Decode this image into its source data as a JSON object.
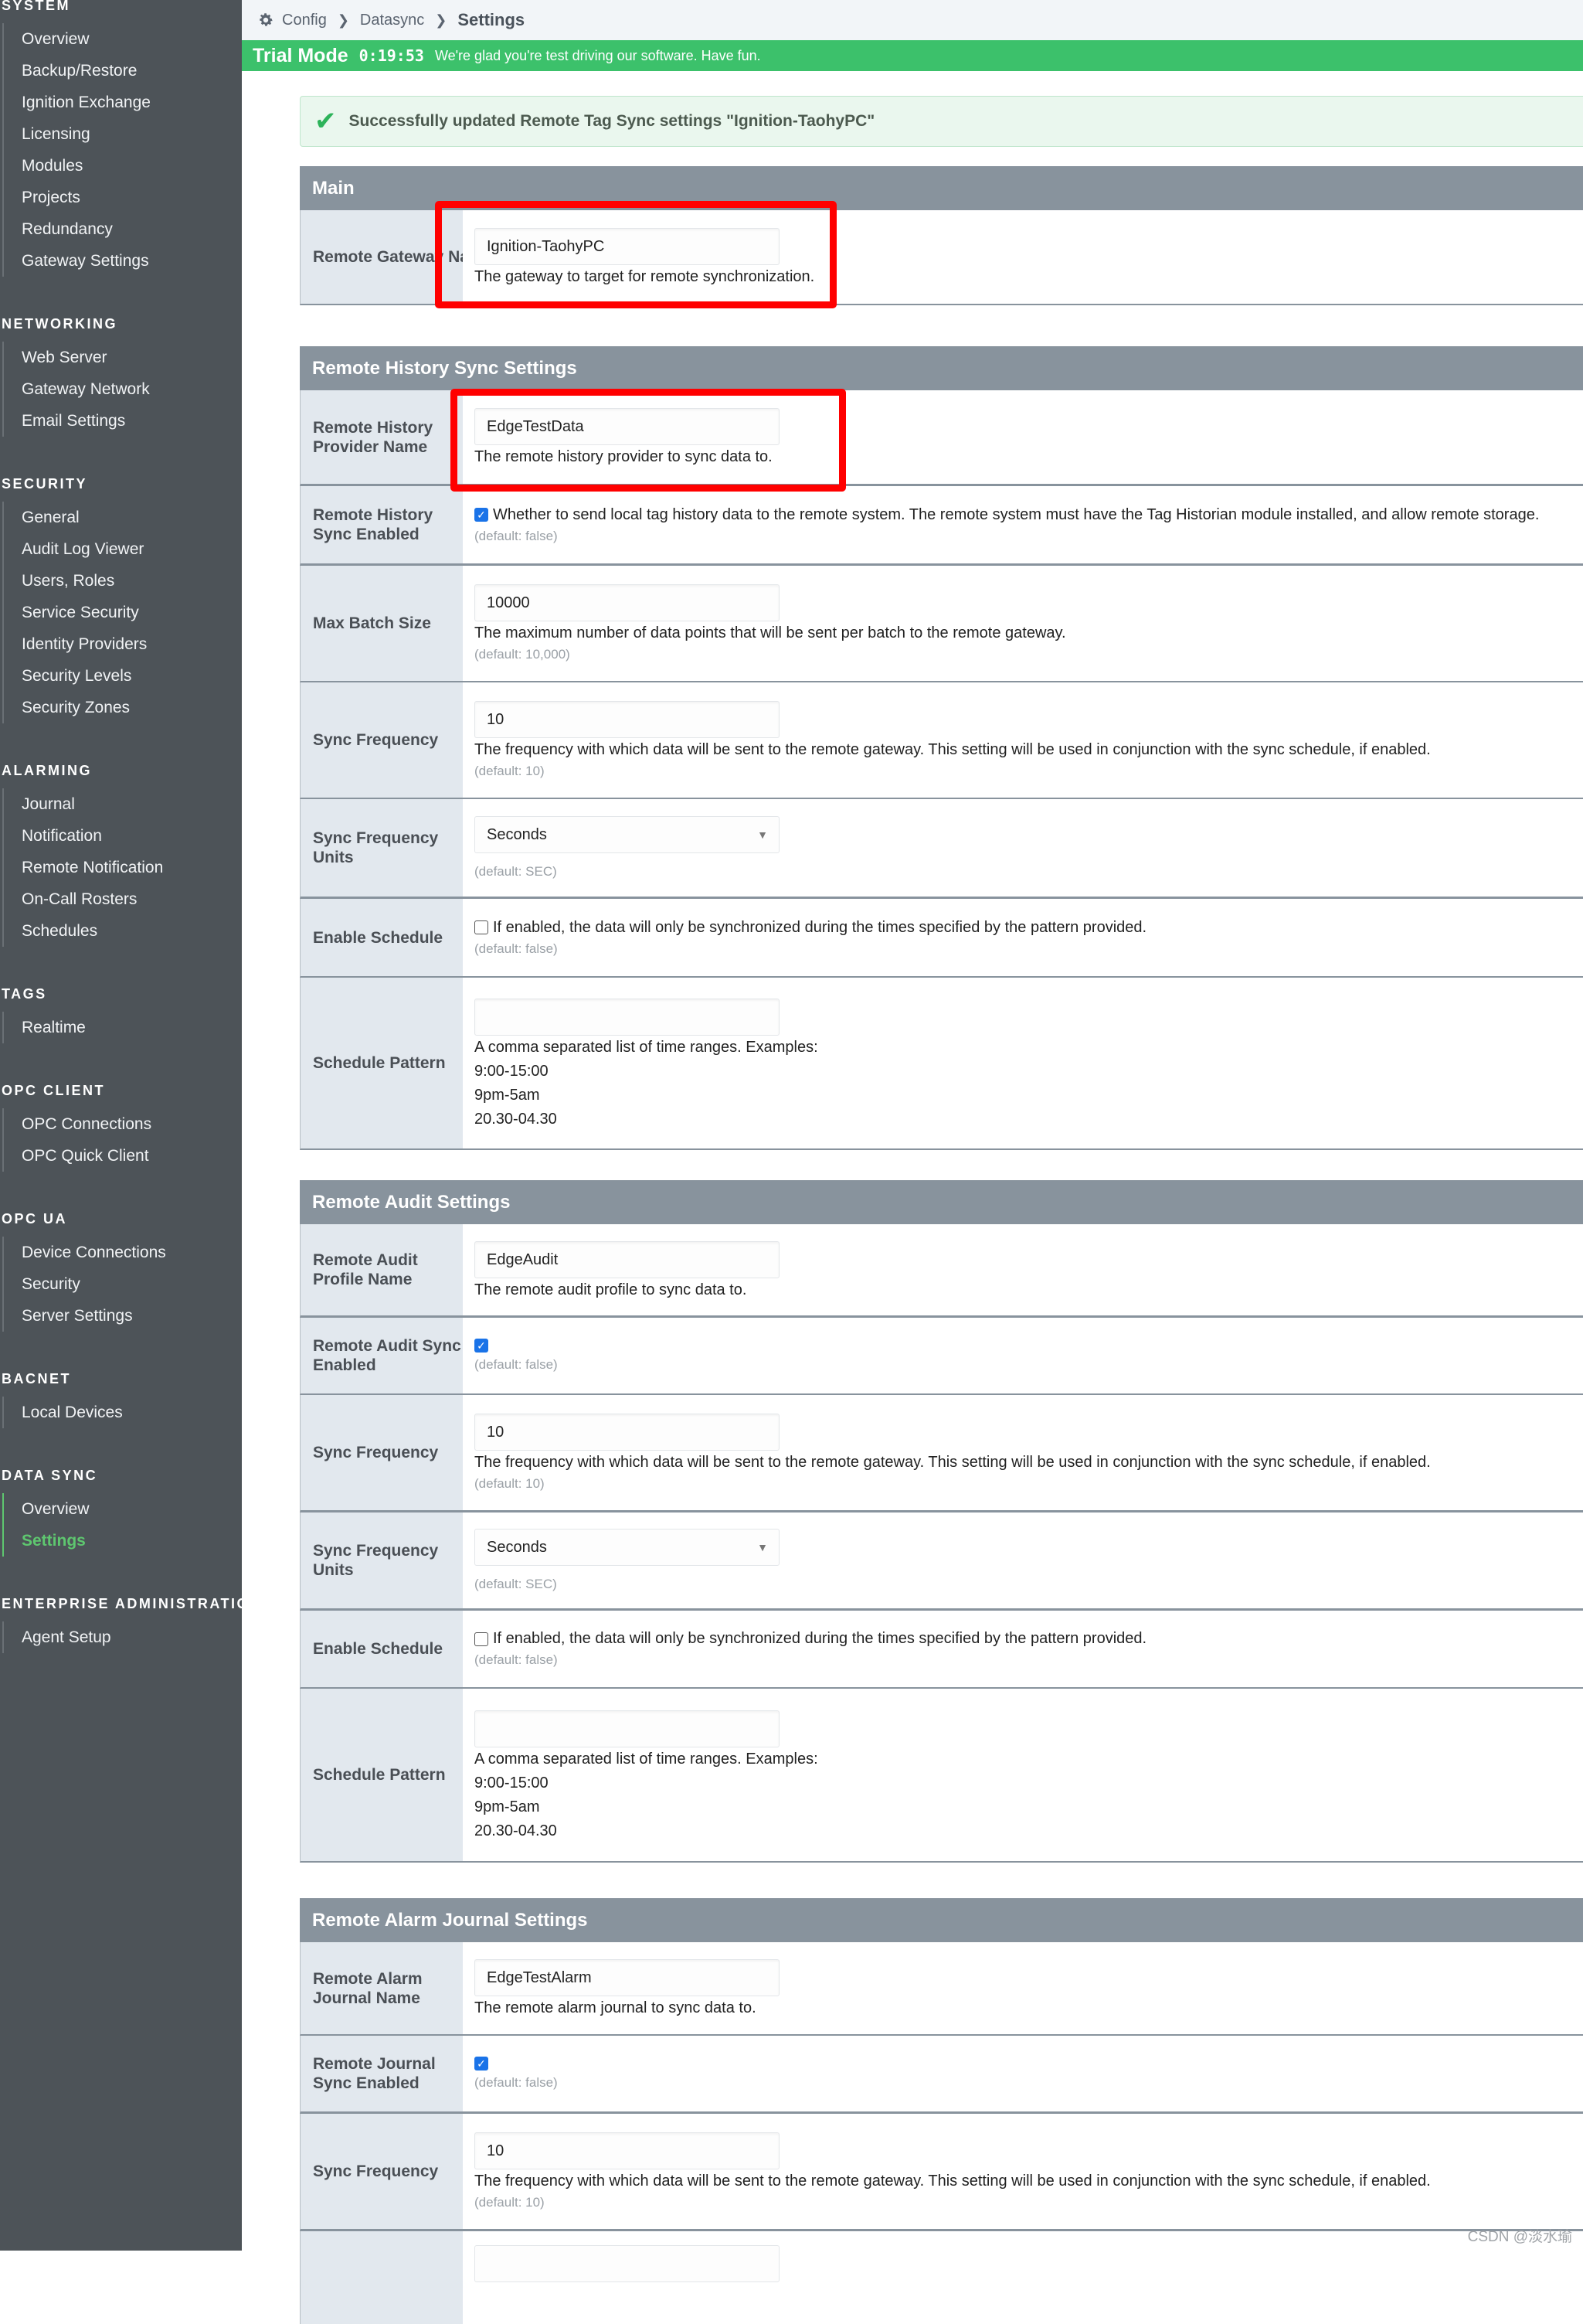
{
  "breadcrumb": {
    "items": [
      "Config",
      "Datasync"
    ],
    "current": "Settings",
    "icon": "gear-icon"
  },
  "trial": {
    "mode": "Trial Mode",
    "timer": "0:19:53",
    "message": "We're glad you're test driving our software. Have fun."
  },
  "success": {
    "icon": "check-icon",
    "message": "Successfully updated Remote Tag Sync settings \"Ignition-TaohyPC\""
  },
  "sidebar": {
    "groups": [
      {
        "header": "SYSTEM",
        "items": [
          "Overview",
          "Backup/Restore",
          "Ignition Exchange",
          "Licensing",
          "Modules",
          "Projects",
          "Redundancy",
          "Gateway Settings"
        ]
      },
      {
        "header": "NETWORKING",
        "items": [
          "Web Server",
          "Gateway Network",
          "Email Settings"
        ]
      },
      {
        "header": "SECURITY",
        "items": [
          "General",
          "Audit Log Viewer",
          "Users, Roles",
          "Service Security",
          "Identity Providers",
          "Security Levels",
          "Security Zones"
        ]
      },
      {
        "header": "ALARMING",
        "items": [
          "Journal",
          "Notification",
          "Remote Notification",
          "On-Call Rosters",
          "Schedules"
        ]
      },
      {
        "header": "TAGS",
        "items": [
          "Realtime"
        ]
      },
      {
        "header": "OPC CLIENT",
        "items": [
          "OPC Connections",
          "OPC Quick Client"
        ]
      },
      {
        "header": "OPC UA",
        "items": [
          "Device Connections",
          "Security",
          "Server Settings"
        ]
      },
      {
        "header": "BACNET",
        "items": [
          "Local Devices"
        ]
      },
      {
        "header": "DATA SYNC",
        "items": [
          "Overview",
          "Settings"
        ],
        "active_index": 1
      },
      {
        "header": "ENTERPRISE ADMINISTRATION",
        "items": [
          "Agent Setup"
        ]
      }
    ]
  },
  "main": {
    "title": "Main",
    "gateway_label": "Remote Gateway Name",
    "gateway_value": "Ignition-TaohyPC",
    "gateway_help": "The gateway to target for remote synchronization."
  },
  "history": {
    "title": "Remote History Sync Settings",
    "provider_label": "Remote History Provider Name",
    "provider_value": "EdgeTestData",
    "provider_help": "The remote history provider to sync data to.",
    "enabled_label": "Remote History Sync Enabled",
    "enabled_checked": true,
    "enabled_help": "Whether to send local tag history data to the remote system. The remote system must have the Tag Historian module installed, and allow remote storage.",
    "enabled_default": "(default: false)",
    "batch_label": "Max Batch Size",
    "batch_value": "10000",
    "batch_help": "The maximum number of data points that will be sent per batch to the remote gateway.",
    "batch_default": "(default: 10,000)",
    "freq_label": "Sync Frequency",
    "freq_value": "10",
    "freq_help": "The frequency with which data will be sent to the remote gateway. This setting will be used in conjunction with the sync schedule, if enabled.",
    "freq_default": "(default: 10)",
    "units_label": "Sync Frequency Units",
    "units_value": "Seconds",
    "units_default": "(default: SEC)",
    "schedule_label": "Enable Schedule",
    "schedule_checked": false,
    "schedule_help": "If enabled, the data will only be synchronized during the times specified by the pattern provided.",
    "schedule_default": "(default: false)",
    "pattern_label": "Schedule Pattern",
    "pattern_value": "",
    "pattern_help": "A comma separated list of time ranges. Examples:",
    "pattern_examples": [
      "9:00-15:00",
      "9pm-5am",
      "20.30-04.30"
    ]
  },
  "audit": {
    "title": "Remote Audit Settings",
    "profile_label": "Remote Audit Profile Name",
    "profile_value": "EdgeAudit",
    "profile_help": "The remote audit profile to sync data to.",
    "enabled_label": "Remote Audit Sync Enabled",
    "enabled_checked": true,
    "enabled_default": "(default: false)",
    "freq_label": "Sync Frequency",
    "freq_value": "10",
    "freq_help": "The frequency with which data will be sent to the remote gateway. This setting will be used in conjunction with the sync schedule, if enabled.",
    "freq_default": "(default: 10)",
    "units_label": "Sync Frequency Units",
    "units_value": "Seconds",
    "units_default": "(default: SEC)",
    "schedule_label": "Enable Schedule",
    "schedule_checked": false,
    "schedule_help": "If enabled, the data will only be synchronized during the times specified by the pattern provided.",
    "schedule_default": "(default: false)",
    "pattern_label": "Schedule Pattern",
    "pattern_value": "",
    "pattern_help": "A comma separated list of time ranges. Examples:",
    "pattern_examples": [
      "9:00-15:00",
      "9pm-5am",
      "20.30-04.30"
    ]
  },
  "alarm": {
    "title": "Remote Alarm Journal Settings",
    "journal_label": "Remote Alarm Journal Name",
    "journal_value": "EdgeTestAlarm",
    "journal_help": "The remote alarm journal to sync data to.",
    "enabled_label": "Remote Journal Sync Enabled",
    "enabled_checked": true,
    "enabled_default": "(default: false)",
    "freq_label": "Sync Frequency",
    "freq_value": "10",
    "freq_help": "The frequency with which data will be sent to the remote gateway. This setting will be used in conjunction with the sync schedule, if enabled.",
    "freq_default": "(default: 10)"
  },
  "colors": {
    "sidebar_bg": "#4d5358",
    "trial_green": "#3cc16b",
    "active_nav": "#5ec76f",
    "section_header": "#88939d",
    "annotation_red": "#ff0000",
    "checkbox_blue": "#1a73e8"
  },
  "watermark": "CSDN @淡水瑜"
}
